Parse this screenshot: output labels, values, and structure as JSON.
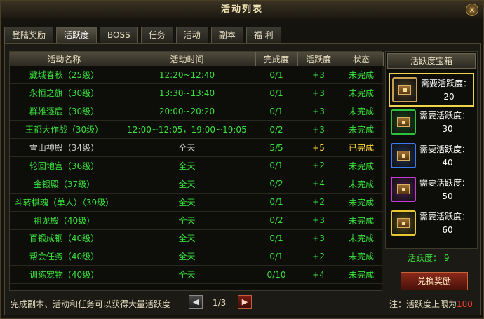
{
  "window": {
    "title": "活动列表",
    "close_label": "×"
  },
  "tabs": [
    {
      "label": "登陆奖励",
      "active": false
    },
    {
      "label": "活跃度",
      "active": true
    },
    {
      "label": "BOSS",
      "active": false
    },
    {
      "label": "任务",
      "active": false
    },
    {
      "label": "活动",
      "active": false
    },
    {
      "label": "副本",
      "active": false
    },
    {
      "label": "福 利",
      "active": false
    }
  ],
  "table": {
    "headers": [
      "活动名称",
      "活动时间",
      "完成度",
      "活跃度",
      "状态"
    ],
    "rows": [
      {
        "name": "藏城春秋（25级）",
        "time": "12:20~12:40",
        "progress": "0/1",
        "activity": "+3",
        "status": "未完成",
        "done": false
      },
      {
        "name": "永恒之旗（30级）",
        "time": "13:30~13:40",
        "progress": "0/1",
        "activity": "+3",
        "status": "未完成",
        "done": false
      },
      {
        "name": "群雄逐鹿（30级）",
        "time": "20:00~20:20",
        "progress": "0/1",
        "activity": "+3",
        "status": "未完成",
        "done": false
      },
      {
        "name": "王都大作战（30级）",
        "time": "12:00~12:05，19:00~19:05",
        "progress": "0/2",
        "activity": "+3",
        "status": "未完成",
        "done": false
      },
      {
        "name": "雪山神殿（34级）",
        "time": "全天",
        "progress": "5/5",
        "activity": "+5",
        "status": "已完成",
        "done": true
      },
      {
        "name": "轮回地宫（36级）",
        "time": "全天",
        "progress": "0/1",
        "activity": "+2",
        "status": "未完成",
        "done": false
      },
      {
        "name": "金银殿（37级）",
        "time": "全天",
        "progress": "0/2",
        "activity": "+4",
        "status": "未完成",
        "done": false
      },
      {
        "name": "斗转棋魂（单人）（39级）",
        "time": "全天",
        "progress": "0/1",
        "activity": "+2",
        "status": "未完成",
        "done": false
      },
      {
        "name": "祖龙殿（40级）",
        "time": "全天",
        "progress": "0/2",
        "activity": "+3",
        "status": "未完成",
        "done": false
      },
      {
        "name": "百锻成钢（40级）",
        "time": "全天",
        "progress": "0/1",
        "activity": "+3",
        "status": "未完成",
        "done": false
      },
      {
        "name": "帮会任务（40级）",
        "time": "全天",
        "progress": "0/1",
        "activity": "+2",
        "status": "未完成",
        "done": false
      },
      {
        "name": "训练宠物（40级）",
        "time": "全天",
        "progress": "0/10",
        "activity": "+4",
        "status": "未完成",
        "done": false
      }
    ]
  },
  "side": {
    "header": "活跃度宝箱",
    "chests": [
      {
        "label": "需要活跃度：",
        "value": "20",
        "border": "#c8a050",
        "selected": true,
        "icon": "chest-bronze-icon"
      },
      {
        "label": "需要活跃度：",
        "value": "30",
        "border": "#2cc23a",
        "selected": false,
        "icon": "chest-green-icon"
      },
      {
        "label": "需要活跃度：",
        "value": "40",
        "border": "#3a7af0",
        "selected": false,
        "icon": "chest-blue-icon"
      },
      {
        "label": "需要活跃度：",
        "value": "50",
        "border": "#c83ad8",
        "selected": false,
        "icon": "chest-purple-icon"
      },
      {
        "label": "需要活跃度：",
        "value": "60",
        "border": "#e8c830",
        "selected": false,
        "icon": "chest-gold-icon"
      }
    ],
    "activity_label": "活跃度：",
    "activity_value": "9",
    "redeem_label": "兑换奖励"
  },
  "footer": {
    "hint": "完成副本、活动和任务可以获得大量活跃度",
    "page": "1/3",
    "prev_label": "◀",
    "next_label": "▶",
    "cap_prefix": "注：活跃度上限为",
    "cap_value": "100"
  }
}
